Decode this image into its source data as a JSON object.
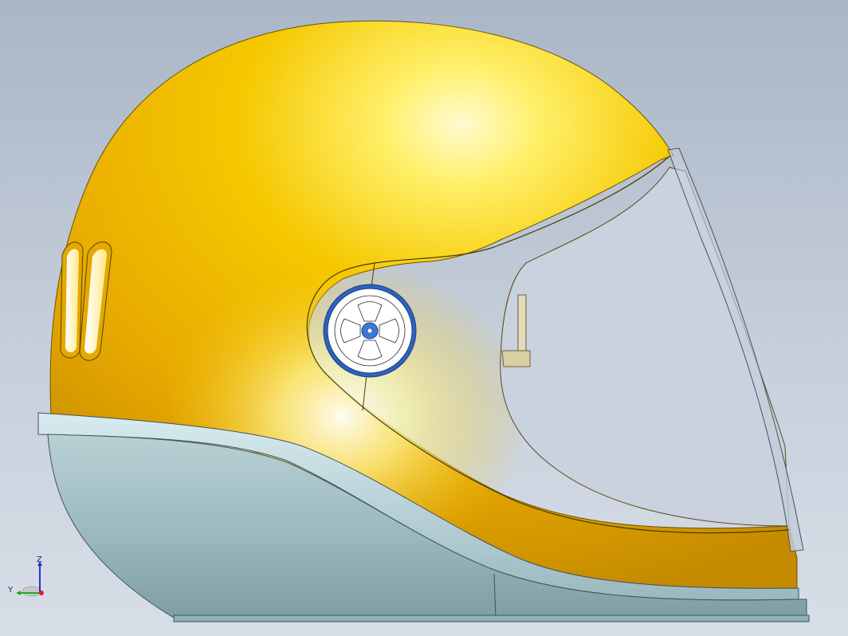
{
  "viewport": {
    "background_top": "#aab6c6",
    "background_bottom": "#d8dee7"
  },
  "model": {
    "shell_color": "#f2c200",
    "highlight_color": "#fff8b0",
    "chin_base_color": "#a8c4c8",
    "visor_color": "#c4ced8",
    "pivot_color": "#2f62c0"
  },
  "triad": {
    "z_label": "Z",
    "y_label": "Y",
    "z_color": "#2233cc",
    "y_color": "#22aa22",
    "origin_color": "#dd2222"
  }
}
